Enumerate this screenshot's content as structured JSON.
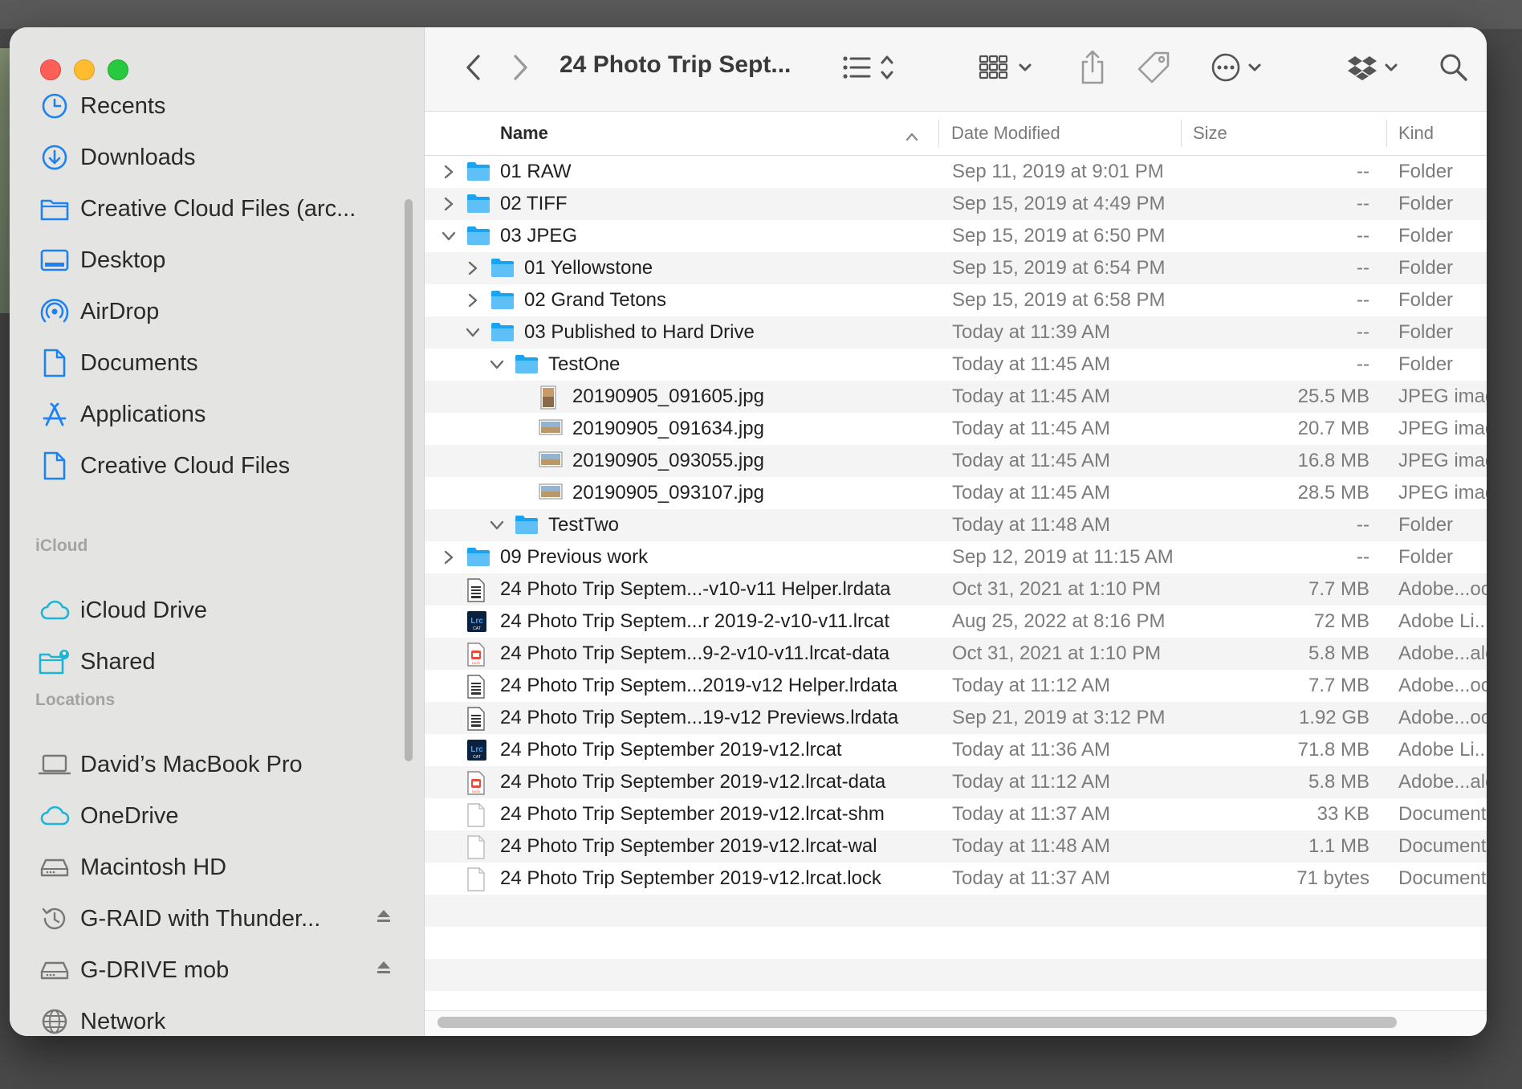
{
  "window": {
    "title": "24 Photo Trip Sept...",
    "accent": "#1e82f0"
  },
  "sidebar": {
    "favorites": [
      {
        "label": "Recents",
        "icon": "clock-icon"
      },
      {
        "label": "Downloads",
        "icon": "download-icon"
      },
      {
        "label": "Creative Cloud Files (arc...",
        "icon": "folder-icon"
      },
      {
        "label": "Desktop",
        "icon": "desktop-icon"
      },
      {
        "label": "AirDrop",
        "icon": "airdrop-icon"
      },
      {
        "label": "Documents",
        "icon": "document-icon"
      },
      {
        "label": "Applications",
        "icon": "applications-icon"
      },
      {
        "label": "Creative Cloud Files",
        "icon": "document-icon"
      }
    ],
    "icloud_heading": "iCloud",
    "icloud": [
      {
        "label": "iCloud Drive",
        "icon": "cloud-icon"
      },
      {
        "label": "Shared",
        "icon": "shared-folder-icon"
      }
    ],
    "locations_heading": "Locations",
    "locations": [
      {
        "label": "David’s MacBook Pro",
        "icon": "laptop-icon"
      },
      {
        "label": "OneDrive",
        "icon": "cloud-icon"
      },
      {
        "label": "Macintosh HD",
        "icon": "drive-icon"
      },
      {
        "label": "G-RAID with Thunder...",
        "icon": "time-machine-icon",
        "eject": true
      },
      {
        "label": "G-DRIVE mob",
        "icon": "drive-icon",
        "eject": true
      },
      {
        "label": "Network",
        "icon": "globe-icon"
      }
    ]
  },
  "columns": {
    "name": "Name",
    "date": "Date Modified",
    "size": "Size",
    "kind": "Kind"
  },
  "files": [
    {
      "name": "01 RAW",
      "date": "Sep 11, 2019 at 9:01 PM",
      "size": "--",
      "kind": "Folder",
      "level": 0,
      "type": "folder",
      "disclosure": "closed"
    },
    {
      "name": "02 TIFF",
      "date": "Sep 15, 2019 at 4:49 PM",
      "size": "--",
      "kind": "Folder",
      "level": 0,
      "type": "folder",
      "disclosure": "closed"
    },
    {
      "name": "03 JPEG",
      "date": "Sep 15, 2019 at 6:50 PM",
      "size": "--",
      "kind": "Folder",
      "level": 0,
      "type": "folder",
      "disclosure": "open"
    },
    {
      "name": "01 Yellowstone",
      "date": "Sep 15, 2019 at 6:54 PM",
      "size": "--",
      "kind": "Folder",
      "level": 1,
      "type": "folder",
      "disclosure": "closed"
    },
    {
      "name": "02 Grand Tetons",
      "date": "Sep 15, 2019 at 6:58 PM",
      "size": "--",
      "kind": "Folder",
      "level": 1,
      "type": "folder",
      "disclosure": "closed"
    },
    {
      "name": "03 Published to Hard Drive",
      "date": "Today at 11:39 AM",
      "size": "--",
      "kind": "Folder",
      "level": 1,
      "type": "folder",
      "disclosure": "open"
    },
    {
      "name": "TestOne",
      "date": "Today at 11:45 AM",
      "size": "--",
      "kind": "Folder",
      "level": 2,
      "type": "folder",
      "disclosure": "open"
    },
    {
      "name": "20190905_091605.jpg",
      "date": "Today at 11:45 AM",
      "size": "25.5 MB",
      "kind": "JPEG image",
      "level": 3,
      "type": "image-portrait",
      "disclosure": "none"
    },
    {
      "name": "20190905_091634.jpg",
      "date": "Today at 11:45 AM",
      "size": "20.7 MB",
      "kind": "JPEG image",
      "level": 3,
      "type": "image",
      "disclosure": "none"
    },
    {
      "name": "20190905_093055.jpg",
      "date": "Today at 11:45 AM",
      "size": "16.8 MB",
      "kind": "JPEG image",
      "level": 3,
      "type": "image",
      "disclosure": "none"
    },
    {
      "name": "20190905_093107.jpg",
      "date": "Today at 11:45 AM",
      "size": "28.5 MB",
      "kind": "JPEG image",
      "level": 3,
      "type": "image",
      "disclosure": "none"
    },
    {
      "name": "TestTwo",
      "date": "Today at 11:48 AM",
      "size": "--",
      "kind": "Folder",
      "level": 2,
      "type": "folder",
      "disclosure": "open"
    },
    {
      "name": "09 Previous work",
      "date": "Sep 12, 2019 at 11:15 AM",
      "size": "--",
      "kind": "Folder",
      "level": 0,
      "type": "folder",
      "disclosure": "closed"
    },
    {
      "name": "24 Photo Trip Septem...-v10-v11 Helper.lrdata",
      "date": "Oct 31, 2021 at 1:10 PM",
      "size": "7.7 MB",
      "kind": "Adobe...ook",
      "level": 0,
      "type": "data",
      "disclosure": "none"
    },
    {
      "name": "24 Photo Trip Septem...r 2019-2-v10-v11.lrcat",
      "date": "Aug 25, 2022 at 8:16 PM",
      "size": "72 MB",
      "kind": "Adobe Li...l",
      "level": 0,
      "type": "lrcat",
      "disclosure": "none"
    },
    {
      "name": "24 Photo Trip Septem...9-2-v10-v11.lrcat-data",
      "date": "Oct 31, 2021 at 1:10 PM",
      "size": "5.8 MB",
      "kind": "Adobe...alo",
      "level": 0,
      "type": "red-data",
      "disclosure": "none"
    },
    {
      "name": "24 Photo Trip Septem...2019-v12 Helper.lrdata",
      "date": "Today at 11:12 AM",
      "size": "7.7 MB",
      "kind": "Adobe...ook",
      "level": 0,
      "type": "data",
      "disclosure": "none"
    },
    {
      "name": "24 Photo Trip Septem...19-v12 Previews.lrdata",
      "date": "Sep 21, 2019 at 3:12 PM",
      "size": "1.92 GB",
      "kind": "Adobe...ook",
      "level": 0,
      "type": "data",
      "disclosure": "none"
    },
    {
      "name": "24 Photo Trip September 2019-v12.lrcat",
      "date": "Today at 11:36 AM",
      "size": "71.8 MB",
      "kind": "Adobe Li...l",
      "level": 0,
      "type": "lrcat",
      "disclosure": "none"
    },
    {
      "name": "24 Photo Trip September 2019-v12.lrcat-data",
      "date": "Today at 11:12 AM",
      "size": "5.8 MB",
      "kind": "Adobe...alo",
      "level": 0,
      "type": "red-data",
      "disclosure": "none"
    },
    {
      "name": "24 Photo Trip September 2019-v12.lrcat-shm",
      "date": "Today at 11:37 AM",
      "size": "33 KB",
      "kind": "Document",
      "level": 0,
      "type": "blank",
      "disclosure": "none"
    },
    {
      "name": "24 Photo Trip September 2019-v12.lrcat-wal",
      "date": "Today at 11:48 AM",
      "size": "1.1 MB",
      "kind": "Document",
      "level": 0,
      "type": "blank",
      "disclosure": "none"
    },
    {
      "name": "24 Photo Trip September 2019-v12.lrcat.lock",
      "date": "Today at 11:37 AM",
      "size": "71 bytes",
      "kind": "Document",
      "level": 0,
      "type": "blank",
      "disclosure": "none"
    }
  ]
}
